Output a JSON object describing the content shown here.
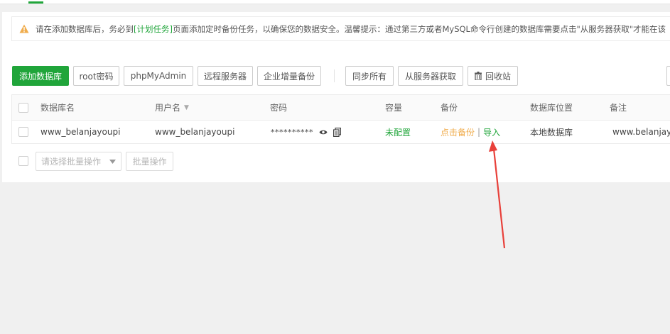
{
  "notice": {
    "text_before": "请在添加数据库后，务必到",
    "link_text": "[计划任务]",
    "text_after": "页面添加定时备份任务，以确保您的数据安全。温馨提示：通过第三方或者MySQL命令行创建的数据库需要点击\"从服务器获取\"才能在该"
  },
  "toolbar": {
    "add_db": "添加数据库",
    "root_pwd": "root密码",
    "phpmyadmin": "phpMyAdmin",
    "remote_server": "远程服务器",
    "enterprise_backup": "企业增量备份",
    "sync_all": "同步所有",
    "fetch_from_server": "从服务器获取",
    "recycle_bin": "回收站"
  },
  "table": {
    "headers": {
      "db_name": "数据库名",
      "username": "用户名",
      "password": "密码",
      "capacity": "容量",
      "backup": "备份",
      "location": "数据库位置",
      "remark": "备注"
    },
    "rows": [
      {
        "db_name": "www_belanjayoupi",
        "username": "www_belanjayoupi",
        "password": "**********",
        "capacity": "未配置",
        "backup_link": "点击备份",
        "import_link": "导入",
        "location": "本地数据库",
        "remark": "www.belanjayo"
      }
    ]
  },
  "footer": {
    "batch_placeholder": "请选择批量操作",
    "batch_button": "批量操作"
  },
  "colors": {
    "accent": "#20a53a",
    "warning": "#f0ad4e",
    "annotation_arrow": "#e8403a"
  }
}
